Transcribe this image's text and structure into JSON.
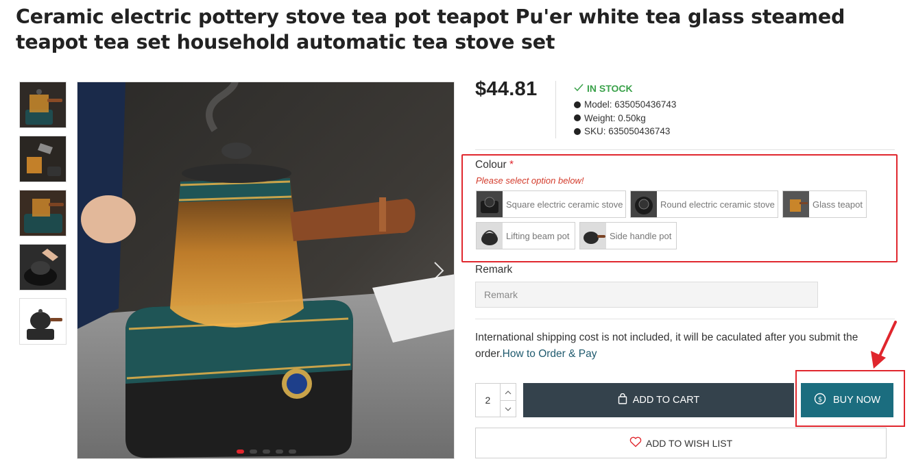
{
  "product": {
    "title": "Ceramic electric pottery stove tea pot teapot Pu'er white tea glass steamed teapot tea set household automatic tea stove set",
    "price": "$44.81",
    "stock": "IN STOCK",
    "meta": [
      "Model: 635050436743",
      "Weight: 0.50kg",
      "SKU: 635050436743"
    ]
  },
  "gallery": {
    "thumbnails": [
      "thumbnail-1",
      "thumbnail-2",
      "thumbnail-3",
      "thumbnail-4",
      "thumbnail-5"
    ],
    "active_slide": 1,
    "slide_count": 5
  },
  "colour": {
    "label": "Colour",
    "required_mark": "*",
    "hint": "Please select option below!",
    "options": [
      "Square electric ceramic stove",
      "Round electric ceramic stove",
      "Glass teapot",
      "Lifting beam pot",
      "Side handle pot"
    ]
  },
  "remark": {
    "label": "Remark",
    "placeholder": "Remark",
    "value": ""
  },
  "shipping": {
    "text": "International shipping cost is not included, it will be caculated after you submit the order.",
    "link": "How to Order & Pay"
  },
  "purchase": {
    "quantity": "2",
    "add_to_cart": "ADD TO CART",
    "buy_now": "BUY NOW",
    "wish_list": "ADD TO WISH LIST"
  },
  "colors": {
    "accent_red": "#e0262d",
    "cart_button": "#34424c",
    "buy_button": "#1b6d7f",
    "stock_green": "#3aa14a"
  }
}
